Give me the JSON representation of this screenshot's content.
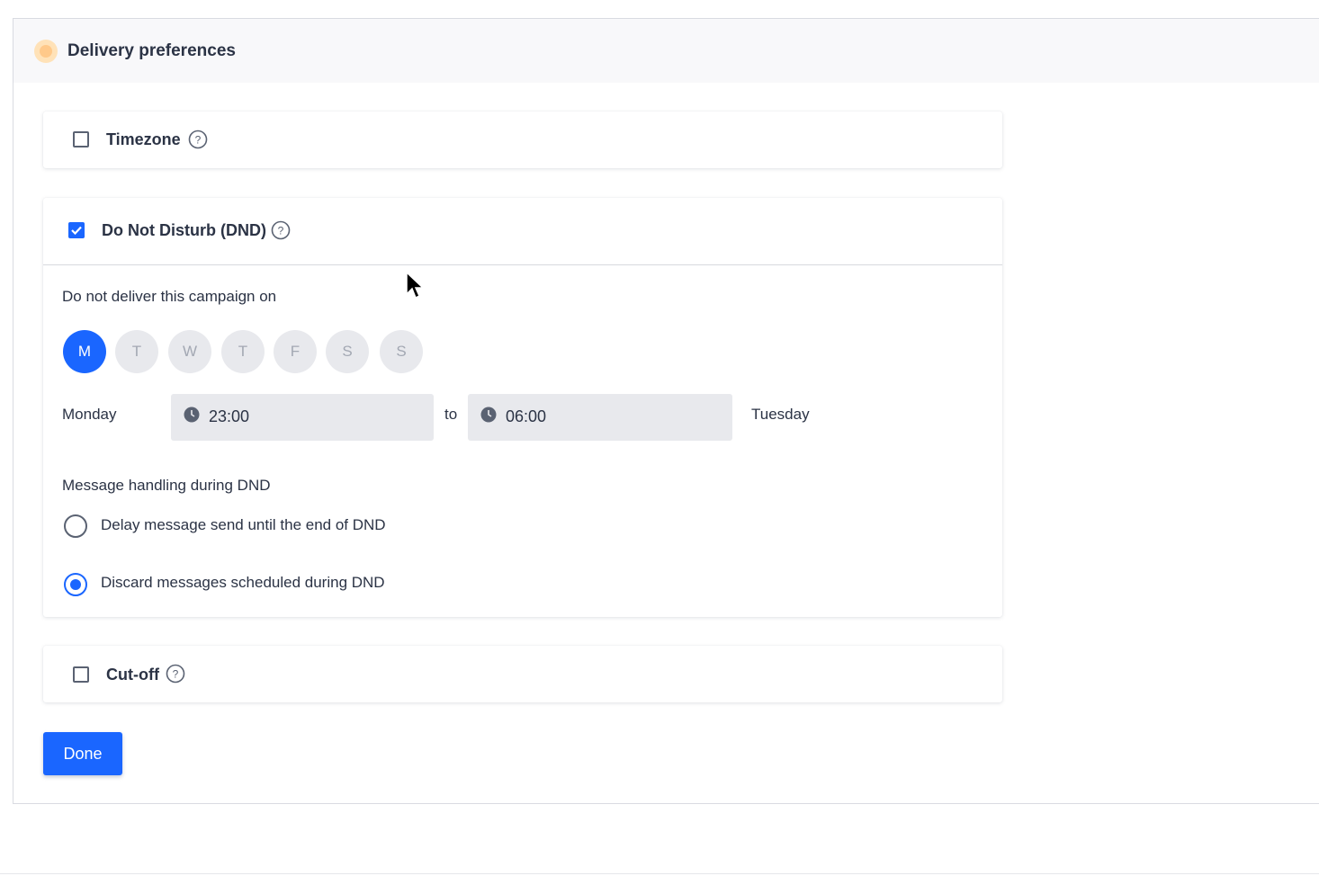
{
  "panel": {
    "title": "Delivery preferences"
  },
  "timezone": {
    "label": "Timezone",
    "checked": false
  },
  "dnd": {
    "label": "Do Not Disturb (DND)",
    "checked": true,
    "days_heading": "Do not deliver this campaign on",
    "days": [
      "M",
      "T",
      "W",
      "T",
      "F",
      "S",
      "S"
    ],
    "selected_day": "M",
    "start_day": "Monday",
    "start_time": "23:00",
    "separator": "to",
    "end_time": "06:00",
    "end_day": "Tuesday",
    "handling_heading": "Message handling during DND",
    "options": [
      {
        "label": "Delay message send until the end of DND",
        "selected": false
      },
      {
        "label": "Discard messages scheduled during DND",
        "selected": true
      }
    ]
  },
  "cutoff": {
    "label": "Cut-off",
    "checked": false
  },
  "actions": {
    "done_label": "Done"
  },
  "colors": {
    "accent": "#1a66ff",
    "status_dot": "#ffc98a",
    "field_bg": "#e8e9ed"
  }
}
